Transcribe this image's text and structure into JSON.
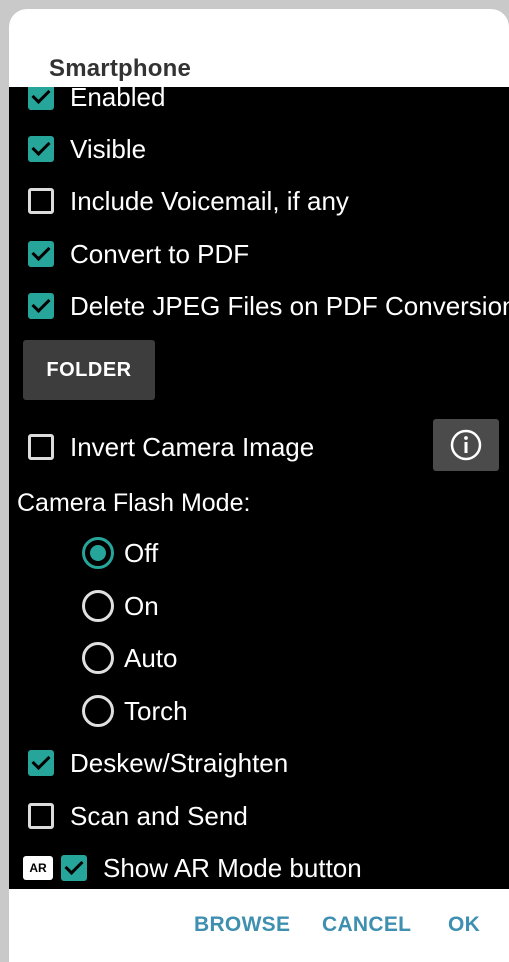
{
  "dialog": {
    "title": "Smartphone"
  },
  "options": {
    "enabled": "Enabled",
    "visible": "Visible",
    "include_voicemail": "Include Voicemail, if any",
    "convert_pdf": "Convert to PDF",
    "delete_jpeg": "Delete JPEG Files on PDF Conversion",
    "invert_camera": "Invert Camera Image",
    "deskew": "Deskew/Straighten",
    "scan_send": "Scan and Send",
    "show_ar": "Show AR Mode button"
  },
  "checked": {
    "enabled": true,
    "visible": true,
    "include_voicemail": false,
    "convert_pdf": true,
    "delete_jpeg": true,
    "invert_camera": false,
    "deskew": true,
    "scan_send": false,
    "show_ar": true
  },
  "folder_button": "FOLDER",
  "flash": {
    "label": "Camera Flash Mode:",
    "options": [
      "Off",
      "On",
      "Auto",
      "Torch"
    ],
    "selected": "Off"
  },
  "ar_badge": "AR",
  "actions": {
    "browse": "BROWSE",
    "cancel": "CANCEL",
    "ok": "OK"
  },
  "colors": {
    "accent": "#26a69a",
    "action_text": "#3e8fb0",
    "content_bg": "#000000"
  },
  "icons": {
    "info": "info-icon"
  }
}
